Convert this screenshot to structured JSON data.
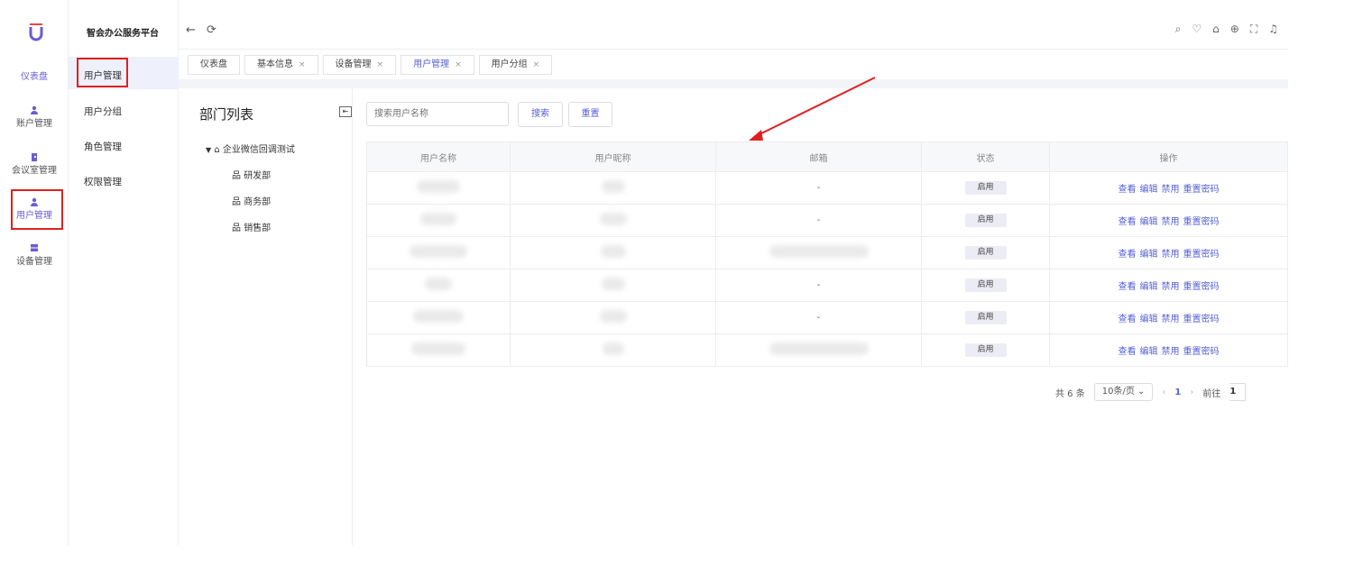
{
  "brand": {
    "title": "智会办公服务平台",
    "accent": "#6b5cd1",
    "link": "#5561d6",
    "highlight": "#e02020"
  },
  "rail": {
    "dashboard": "仪表盘",
    "items": [
      {
        "label": "账户管理",
        "icon": "user-icon"
      },
      {
        "label": "会议室管理",
        "icon": "meeting-room-icon"
      },
      {
        "label": "用户管理",
        "icon": "user-icon",
        "active": true
      },
      {
        "label": "设备管理",
        "icon": "device-icon"
      }
    ]
  },
  "submenu": {
    "items": [
      "用户管理",
      "用户分组",
      "角色管理",
      "权限管理"
    ]
  },
  "header": {
    "icons": [
      "back-arrow-icon",
      "refresh-icon",
      "search-icon",
      "skin-icon",
      "lock-icon",
      "globe-icon",
      "fullscreen-icon",
      "bell-icon"
    ]
  },
  "tabs": [
    {
      "label": "仪表盘",
      "closable": false
    },
    {
      "label": "基本信息",
      "closable": true
    },
    {
      "label": "设备管理",
      "closable": true
    },
    {
      "label": "用户管理",
      "closable": true,
      "active": true
    },
    {
      "label": "用户分组",
      "closable": true
    }
  ],
  "dept": {
    "title": "部门列表",
    "root": "企业微信回调测试",
    "children": [
      "研发部",
      "商务部",
      "销售部"
    ]
  },
  "search": {
    "placeholder": "搜索用户名称",
    "search_btn": "搜索",
    "reset_btn": "重置"
  },
  "table": {
    "columns": [
      "用户名称",
      "用户昵称",
      "邮箱",
      "状态",
      "操作"
    ],
    "rows": [
      {
        "email": "-",
        "status": "启用"
      },
      {
        "email": "-",
        "status": "启用"
      },
      {
        "email": "",
        "status": "启用"
      },
      {
        "email": "-",
        "status": "启用"
      },
      {
        "email": "-",
        "status": "启用"
      },
      {
        "email": "",
        "status": "启用"
      }
    ],
    "actions": [
      "查看",
      "编辑",
      "禁用",
      "重置密码"
    ]
  },
  "pager": {
    "total": "共 6 条",
    "page_size": "10条/页",
    "current": "1",
    "goto": "前往",
    "goto_value": "1"
  }
}
